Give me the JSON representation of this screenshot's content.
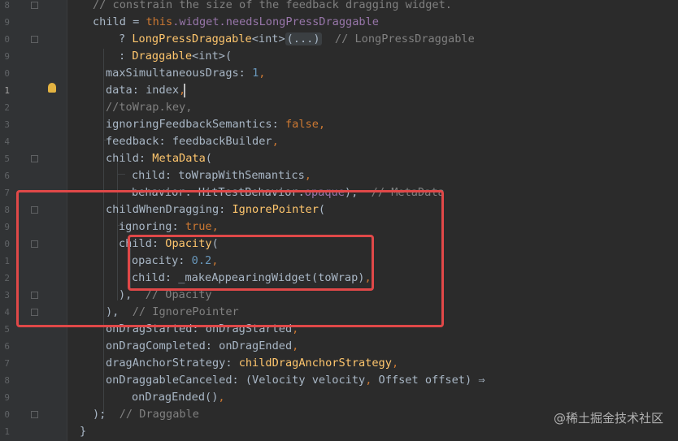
{
  "line_numbers": [
    "8",
    "9",
    "0",
    "9",
    "0",
    "1",
    "2",
    "3",
    "4",
    "5",
    "6",
    "7",
    "8",
    "9",
    "0",
    "1",
    "2",
    "3",
    "4",
    "5",
    "6",
    "7",
    "8",
    "9",
    "0",
    "1"
  ],
  "code": {
    "l0": "// constrain the size of the feedback dragging widget.",
    "l1_prefix": "child = ",
    "l1_this": "this",
    "l1_rest": ".widget.needsLongPressDraggable",
    "l2_q": "? ",
    "l2_cls": "LongPressDraggable",
    "l2_generic": "<int>",
    "l2_fold": "(...)",
    "l2_cmt": "// LongPressDraggable",
    "l3_colon": ": ",
    "l3_cls": "Draggable",
    "l3_rest": "<int>(",
    "l4_prop": "maxSimultaneousDrags: ",
    "l4_num": "1",
    "l4_end": ",",
    "l5_prop": "data: index",
    "l5_end": ",",
    "l6": "//toWrap.key,",
    "l7_prop": "ignoringFeedbackSemantics: ",
    "l7_kw": "false",
    "l7_end": ",",
    "l8_prop": "feedback: feedbackBuilder",
    "l8_end": ",",
    "l9_prop": "child: ",
    "l9_cls": "MetaData",
    "l9_end": "(",
    "l10_prop": "child: toWrapWithSemantics",
    "l10_end": ",",
    "l11_prop": "behavior: HitTestBehavior.",
    "l11_val": "opaque",
    "l11_end": "),",
    "l11_cmt": "// MetaData",
    "l12_prop": "childWhenDragging: ",
    "l12_cls": "IgnorePointer",
    "l12_end": "(",
    "l13_prop": "ignoring: ",
    "l13_kw": "true",
    "l13_end": ",",
    "l14_prop": "child: ",
    "l14_cls": "Opacity",
    "l14_end": "(",
    "l15_prop": "opacity: ",
    "l15_num": "0.2",
    "l15_end": ",",
    "l16_prop": "child: _makeAppearingWidget(toWrap)",
    "l16_end": ",",
    "l17_end": "),",
    "l17_cmt": "// Opacity",
    "l18_end": "),",
    "l18_cmt": "// IgnorePointer",
    "l19_prop": "onDragStarted: onDragStarted",
    "l19_end": ",",
    "l20_prop": "onDragCompleted: onDragEnded",
    "l20_end": ",",
    "l21_prop": "dragAnchorStrategy: ",
    "l21_cls": "childDragAnchorStrategy",
    "l21_end": ",",
    "l22_prop": "onDraggableCanceled: (Velocity velocity",
    "l22_comma": ",",
    "l22_rest": " Offset offset) ⇒",
    "l23_prop": "onDragEnded()",
    "l23_end": ",",
    "l24_end": ");",
    "l24_cmt": "// Draggable",
    "l25": "}"
  },
  "watermark": "@稀土掘金技术社区",
  "colors": {
    "background": "#2b2b2b",
    "keyword": "#cc7832",
    "class": "#ffc66d",
    "number": "#6897bb",
    "comment": "#808080",
    "highlight": "#e04848"
  },
  "icons": {
    "intention": "lightbulb-icon",
    "fold": "fold-marker-icon"
  }
}
